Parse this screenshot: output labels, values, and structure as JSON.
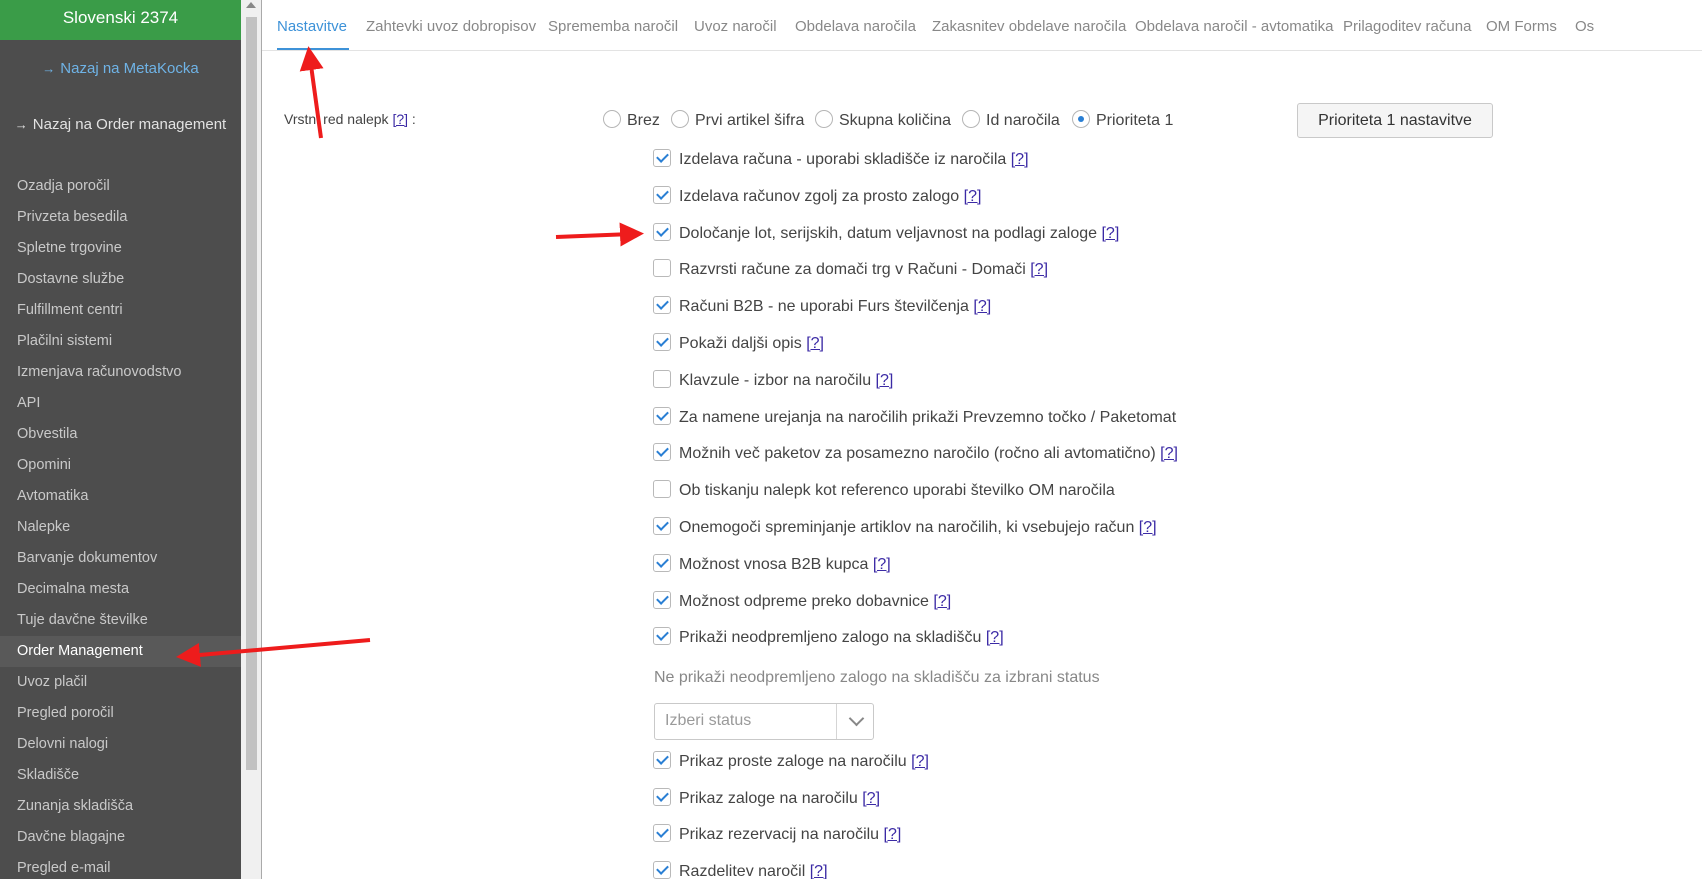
{
  "sidebar": {
    "header": "Slovenski 2374",
    "back_metakocka": "Nazaj na MetaKocka",
    "back_om": "Nazaj na Order management",
    "items": [
      {
        "label": "Ozadja poročil"
      },
      {
        "label": "Privzeta besedila"
      },
      {
        "label": "Spletne trgovine"
      },
      {
        "label": "Dostavne službe"
      },
      {
        "label": "Fulfillment centri"
      },
      {
        "label": "Plačilni sistemi"
      },
      {
        "label": "Izmenjava računovodstvo"
      },
      {
        "label": "API"
      },
      {
        "label": "Obvestila"
      },
      {
        "label": "Opomini"
      },
      {
        "label": "Avtomatika"
      },
      {
        "label": "Nalepke"
      },
      {
        "label": "Barvanje dokumentov"
      },
      {
        "label": "Decimalna mesta"
      },
      {
        "label": "Tuje davčne številke"
      },
      {
        "label": "Order Management",
        "active": true
      },
      {
        "label": "Uvoz plačil"
      },
      {
        "label": "Pregled poročil"
      },
      {
        "label": "Delovni nalogi"
      },
      {
        "label": "Skladišče"
      },
      {
        "label": "Zunanja skladišča"
      },
      {
        "label": "Davčne blagajne"
      },
      {
        "label": "Pregled e-mail"
      }
    ]
  },
  "tabs": [
    {
      "label": "Nastavitve",
      "active": true
    },
    {
      "label": "Zahtevki uvoz dobropisov"
    },
    {
      "label": "Sprememba naročil"
    },
    {
      "label": "Uvoz naročil"
    },
    {
      "label": "Obdelava naročila"
    },
    {
      "label": "Zakasnitev obdelave naročila"
    },
    {
      "label": "Obdelava naročil - avtomatika"
    },
    {
      "label": "Prilagoditev računa"
    },
    {
      "label": "OM Forms"
    },
    {
      "label": "Os"
    }
  ],
  "label_sort": {
    "label": "Vrstni red nalepk",
    "help": "[?]",
    "colon": ":",
    "options": [
      {
        "label": "Brez",
        "selected": false
      },
      {
        "label": "Prvi artikel šifra",
        "selected": false
      },
      {
        "label": "Skupna količina",
        "selected": false
      },
      {
        "label": "Id naročila",
        "selected": false
      },
      {
        "label": "Prioriteta 1",
        "selected": true
      }
    ],
    "button": "Prioriteta 1 nastavitve"
  },
  "checkboxes": [
    {
      "label": "Izdelava računa - uporabi skladišče iz naročila",
      "checked": true,
      "help": "[?]"
    },
    {
      "label": "Izdelava računov zgolj za prosto zalogo",
      "checked": true,
      "help": "[?]"
    },
    {
      "label": "Določanje lot, serijskih, datum veljavnost na podlagi zaloge",
      "checked": true,
      "help": "[?]"
    },
    {
      "label": "Razvrsti račune za domači trg v Računi - Domači",
      "checked": false,
      "help": "[?]"
    },
    {
      "label": "Računi B2B - ne uporabi Furs številčenja",
      "checked": true,
      "help": "[?]"
    },
    {
      "label": "Pokaži daljši opis",
      "checked": true,
      "help": "[?]"
    },
    {
      "label": "Klavzule - izbor na naročilu",
      "checked": false,
      "help": "[?]"
    },
    {
      "label": "Za namene urejanja na naročilih prikaži Prevzemno točko / Paketomat",
      "checked": true,
      "help": ""
    },
    {
      "label": "Možnih več paketov za posamezno naročilo (ročno ali avtomatično)",
      "checked": true,
      "help": "[?]"
    },
    {
      "label": "Ob tiskanju nalepk kot referenco uporabi številko OM naročila",
      "checked": false,
      "help": ""
    },
    {
      "label": "Onemogoči spreminjanje artiklov na naročilih, ki vsebujejo račun",
      "checked": true,
      "help": "[?]"
    },
    {
      "label": "Možnost vnosa B2B kupca",
      "checked": true,
      "help": "[?]"
    },
    {
      "label": "Možnost odpreme preko dobavnice",
      "checked": true,
      "help": "[?]"
    },
    {
      "label": "Prikaži neodpremljeno zalogo na skladišču",
      "checked": true,
      "help": "[?]"
    }
  ],
  "status_filter": {
    "label": "Ne prikaži neodpremljeno zalogo na skladišču za izbrani status",
    "placeholder": "Izberi status"
  },
  "checkboxes_bottom": [
    {
      "label": "Prikaz proste zaloge na naročilu",
      "checked": true,
      "help": "[?]"
    },
    {
      "label": "Prikaz zaloge na naročilu",
      "checked": true,
      "help": "[?]"
    },
    {
      "label": "Prikaz rezervacij na naročilu",
      "checked": true,
      "help": "[?]"
    },
    {
      "label": "Razdelitev naročil",
      "checked": true,
      "help": "[?]"
    }
  ],
  "colors": {
    "sidebar_bg": "#4d4d4d",
    "sidebar_header_bg": "#3a9c48",
    "accent": "#3d92d8",
    "help_link": "#3b2aa5",
    "annotation_arrow": "#ee1c1c"
  }
}
